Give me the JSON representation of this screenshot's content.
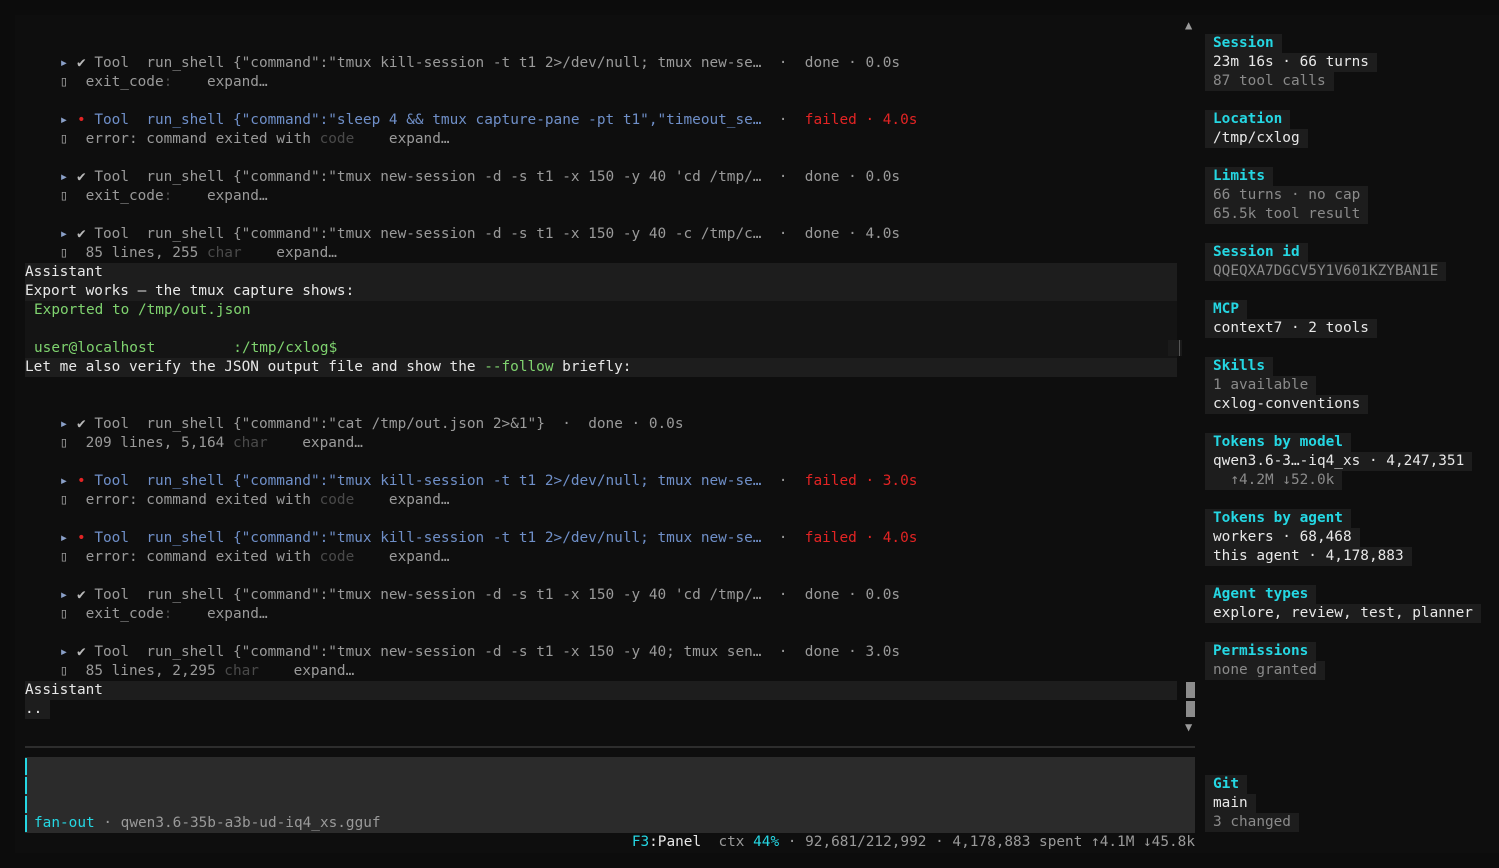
{
  "tools": [
    {
      "id": "t1",
      "marker": "▸",
      "status_icon": "✔",
      "label": "Tool",
      "cmd": "run_shell {\"command\":\"tmux kill-session -t t1 2>/dev/null; tmux new-se…",
      "sep": "·",
      "status": "done · 0.0s",
      "detail_a": "exit_code",
      "detail_b": ":",
      "expand": "expand…"
    },
    {
      "id": "t2",
      "marker": "▸",
      "status_icon": "•",
      "label": "Tool",
      "cmd": "run_shell {\"command\":\"sleep 4 && tmux capture-pane -pt t1\",\"timeout_se…",
      "sep": "·",
      "status": "failed · 4.0s",
      "detail_a": "error: command exited with",
      "detail_b": "code",
      "expand": "expand…"
    },
    {
      "id": "t3",
      "marker": "▸",
      "status_icon": "✔",
      "label": "Tool",
      "cmd": "run_shell {\"command\":\"tmux new-session -d -s t1 -x 150 -y 40 'cd /tmp/…",
      "sep": "·",
      "status": "done · 0.0s",
      "detail_a": "exit_code",
      "detail_b": ":",
      "expand": "expand…"
    },
    {
      "id": "t4",
      "marker": "▸",
      "status_icon": "✔",
      "label": "Tool",
      "cmd": "run_shell {\"command\":\"tmux new-session -d -s t1 -x 150 -y 40 -c /tmp/c…",
      "sep": "·",
      "status": "done · 4.0s",
      "detail_a": "85 lines, 255",
      "detail_b": "char",
      "expand": "expand…"
    },
    {
      "id": "t5",
      "marker": "▸",
      "status_icon": "✔",
      "label": "Tool",
      "cmd": "run_shell {\"command\":\"cat /tmp/out.json 2>&1\"}",
      "sep": "·",
      "status": "done · 0.0s",
      "detail_a": "209 lines, 5,164",
      "detail_b": "char",
      "expand": "expand…"
    },
    {
      "id": "t6",
      "marker": "▸",
      "status_icon": "•",
      "label": "Tool",
      "cmd": "run_shell {\"command\":\"tmux kill-session -t t1 2>/dev/null; tmux new-se…",
      "sep": "·",
      "status": "failed · 3.0s",
      "detail_a": "error: command exited with",
      "detail_b": "code",
      "expand": "expand…"
    },
    {
      "id": "t7",
      "marker": "▸",
      "status_icon": "•",
      "label": "Tool",
      "cmd": "run_shell {\"command\":\"tmux kill-session -t t1 2>/dev/null; tmux new-se…",
      "sep": "·",
      "status": "failed · 4.0s",
      "detail_a": "error: command exited with",
      "detail_b": "code",
      "expand": "expand…"
    },
    {
      "id": "t8",
      "marker": "▸",
      "status_icon": "✔",
      "label": "Tool",
      "cmd": "run_shell {\"command\":\"tmux new-session -d -s t1 -x 150 -y 40 'cd /tmp/…",
      "sep": "·",
      "status": "done · 0.0s",
      "detail_a": "exit_code",
      "detail_b": ":",
      "expand": "expand…"
    },
    {
      "id": "t9",
      "marker": "▸",
      "status_icon": "✔",
      "label": "Tool",
      "cmd": "run_shell {\"command\":\"tmux new-session -d -s t1 -x 150 -y 40; tmux sen…",
      "sep": "·",
      "status": "done · 3.0s",
      "detail_a": "85 lines, 2,295",
      "detail_b": "char",
      "expand": "expand…"
    }
  ],
  "detail_glyph": "▯",
  "assistant1": {
    "label": "Assistant",
    "line1": "Export works — the tmux capture shows:",
    "code1": "Exported to /tmp/out.json",
    "prompt_user": "user@localhost",
    "prompt_path": ":/tmp/cxlog$",
    "line2_pre": "Let me also verify the JSON output file and show the ",
    "line2_flag": "--follow",
    "line2_post": " briefly:"
  },
  "assistant2": {
    "label": "Assistant",
    "line1": ".."
  },
  "scroll": {
    "up": "▲",
    "down": "▼"
  },
  "input": {
    "mode": "fan-out",
    "sep": "·",
    "model": "qwen3.6-35b-a3b-ud-iq4_xs.gguf"
  },
  "status": {
    "key": "F3",
    "key_label": ":Panel",
    "ctx_label": "ctx",
    "ctx_pct": "44%",
    "rest": "· 92,681/212,992 · 4,178,883 spent ↑4.1M ↓45.8k"
  },
  "panel": {
    "session": {
      "title": "Session",
      "v1": "23m 16s · 66 turns",
      "v2": "87 tool calls"
    },
    "location": {
      "title": "Location",
      "v1": "/tmp/cxlog"
    },
    "limits": {
      "title": "Limits",
      "v1": "66 turns · no cap",
      "v2": "65.5k tool result"
    },
    "session_id": {
      "title": "Session id",
      "v1": "QQEQXA7DGCV5Y1V601KZYBAN1E"
    },
    "mcp": {
      "title": "MCP",
      "v1": "context7 · 2 tools"
    },
    "skills": {
      "title": "Skills",
      "v1": "1 available",
      "v2": "cxlog-conventions"
    },
    "tokens_model": {
      "title": "Tokens by model",
      "v1": "qwen3.6-3…-iq4_xs · 4,247,351",
      "v2": "  ↑4.2M ↓52.0k"
    },
    "tokens_agent": {
      "title": "Tokens by agent",
      "v1": "workers · 68,468",
      "v2": "this agent · 4,178,883"
    },
    "agent_types": {
      "title": "Agent types",
      "v1": "explore, review, test, planner"
    },
    "permissions": {
      "title": "Permissions",
      "v1": "none granted"
    },
    "git": {
      "title": "Git",
      "v1": "main",
      "v2": "3 changed"
    }
  }
}
